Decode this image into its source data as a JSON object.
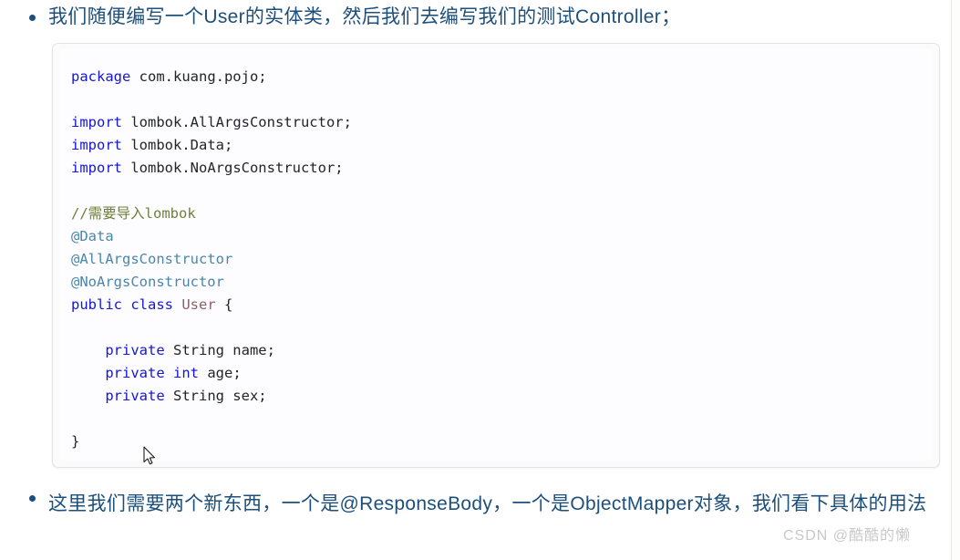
{
  "document": {
    "bullets": [
      {
        "id": "top",
        "text": "我们随便编写一个User的实体类，然后我们去编写我们的测试Controller；"
      },
      {
        "id": "bottom",
        "text": "这里我们需要两个新东西，一个是@ResponseBody，一个是ObjectMapper对象，我们看下具体的用法"
      }
    ]
  },
  "code_block": {
    "language": "java",
    "lines": [
      [
        {
          "t": "kw",
          "v": "package"
        },
        {
          "t": "txt",
          "v": " com.kuang.pojo;"
        }
      ],
      [],
      [
        {
          "t": "kw",
          "v": "import"
        },
        {
          "t": "txt",
          "v": " lombok.AllArgsConstructor;"
        }
      ],
      [
        {
          "t": "kw",
          "v": "import"
        },
        {
          "t": "txt",
          "v": " lombok.Data;"
        }
      ],
      [
        {
          "t": "kw",
          "v": "import"
        },
        {
          "t": "txt",
          "v": " lombok.NoArgsConstructor;"
        }
      ],
      [],
      [
        {
          "t": "cmt",
          "v": "//需要导入lombok"
        }
      ],
      [
        {
          "t": "ann",
          "v": "@Data"
        }
      ],
      [
        {
          "t": "ann",
          "v": "@AllArgsConstructor"
        }
      ],
      [
        {
          "t": "ann",
          "v": "@NoArgsConstructor"
        }
      ],
      [
        {
          "t": "kw",
          "v": "public class"
        },
        {
          "t": "txt",
          "v": " "
        },
        {
          "t": "type",
          "v": "User"
        },
        {
          "t": "txt",
          "v": " {"
        }
      ],
      [],
      [
        {
          "t": "txt",
          "v": "    "
        },
        {
          "t": "kw",
          "v": "private"
        },
        {
          "t": "txt",
          "v": " String name;"
        }
      ],
      [
        {
          "t": "txt",
          "v": "    "
        },
        {
          "t": "kw",
          "v": "private"
        },
        {
          "t": "txt",
          "v": " "
        },
        {
          "t": "kw",
          "v": "int"
        },
        {
          "t": "txt",
          "v": " age;"
        }
      ],
      [
        {
          "t": "txt",
          "v": "    "
        },
        {
          "t": "kw",
          "v": "private"
        },
        {
          "t": "txt",
          "v": " String sex;"
        }
      ],
      [],
      [
        {
          "t": "txt",
          "v": "}"
        }
      ]
    ]
  },
  "watermark": {
    "text": "CSDN @酷酷的懒"
  },
  "colors": {
    "body_text": "#1d4f7c",
    "keyword": "#1515d8",
    "comment": "#6e7f3c",
    "annotation": "#4a86ab",
    "type": "#8d5f63",
    "code_text": "#222428",
    "code_background": "#fdfdff",
    "code_border": "#e3e3e5",
    "watermark": "#c9c9c9",
    "page_background": "#ffffff"
  }
}
